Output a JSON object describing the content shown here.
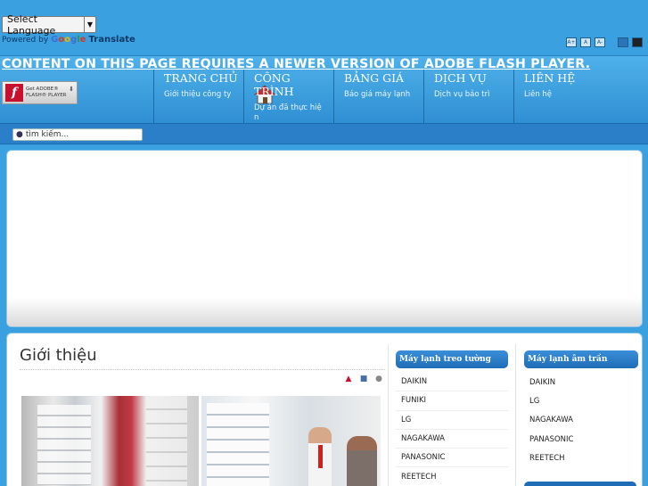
{
  "translate": {
    "select_label": "Select Language",
    "powered_by": "Powered by",
    "google": [
      "G",
      "o",
      "o",
      "g",
      "l",
      "e"
    ],
    "translate": "Translate"
  },
  "font_tools": [
    "A+",
    "A",
    "A-"
  ],
  "flash": {
    "message": "CONTENT ON THIS PAGE REQUIRES A NEWER VERSION OF ADOBE FLASH PLAYER.",
    "badge_line1": "Get ADOBE®",
    "badge_line2": "FLASH® PLAYER"
  },
  "nav": [
    {
      "title": "TRANG CHỦ",
      "subtitle": "Giới thiệu công ty"
    },
    {
      "title": "CÔNG TRÌNH",
      "subtitle": "Dự án đã thực hiệ n"
    },
    {
      "title": "BẢNG GIÁ",
      "subtitle": "Báo giá máy lạnh"
    },
    {
      "title": "DỊCH VỤ",
      "subtitle": "Dịch vụ bảo trì"
    },
    {
      "title": "LIÊN HỆ",
      "subtitle": "Liên hệ"
    }
  ],
  "search": {
    "placeholder": "tìm kiếm..."
  },
  "main": {
    "title": "Giới thiệu"
  },
  "sidebar": {
    "box1": {
      "heading": "Máy lạnh treo tường",
      "items": [
        "DAIKIN",
        "FUNIKI",
        "LG",
        "NAGAKAWA",
        "PANASONIC",
        "REETECH"
      ]
    },
    "box2": {
      "heading": "Máy lạnh âm trần",
      "items": [
        "DAIKIN",
        "LG",
        "NAGAKAWA",
        "PANASONIC",
        "REETECH"
      ]
    }
  },
  "colors": {
    "page_bg": "#3aa0e0",
    "nav_divider": "#1f6aa5",
    "side_header": "#1f6db6"
  }
}
